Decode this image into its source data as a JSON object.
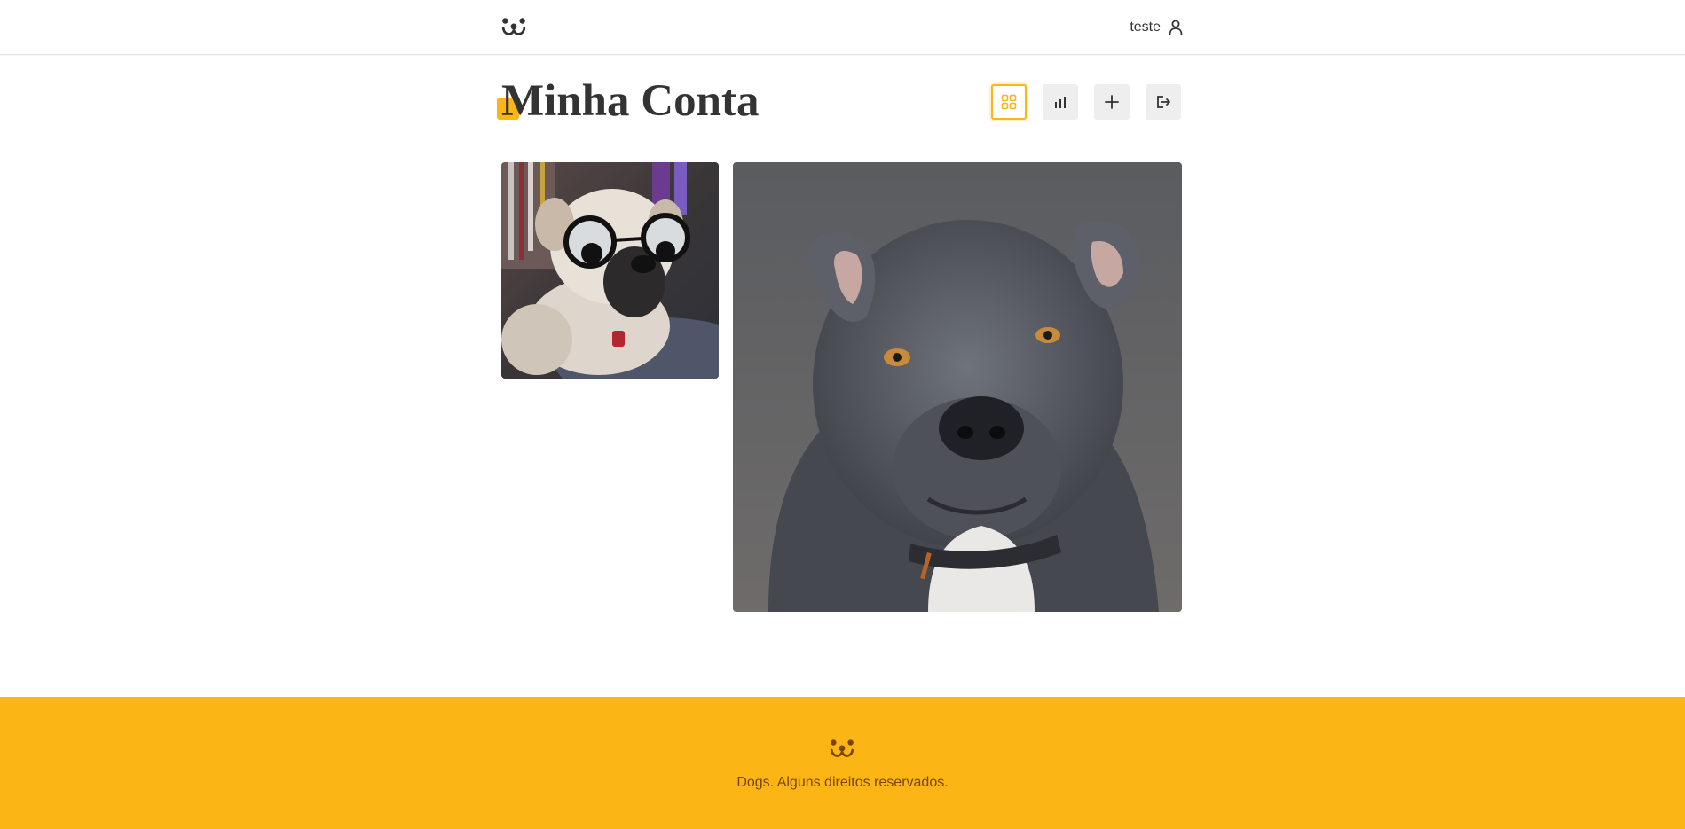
{
  "header": {
    "logo_icon": "dog-face-icon",
    "username": "teste",
    "user_icon": "user-icon"
  },
  "page": {
    "title": "Minha Conta"
  },
  "nav": {
    "items": [
      {
        "name": "feed",
        "icon": "grid-icon",
        "active": true
      },
      {
        "name": "stats",
        "icon": "bar-chart-icon",
        "active": false
      },
      {
        "name": "post",
        "icon": "plus-icon",
        "active": false
      },
      {
        "name": "logout",
        "icon": "logout-icon",
        "active": false
      }
    ]
  },
  "feed": {
    "photos": [
      {
        "subject": "white dog wearing googly-eye glasses"
      },
      {
        "subject": "grey pit bull portrait"
      }
    ]
  },
  "footer": {
    "logo_icon": "dog-face-icon",
    "text": "Dogs. Alguns direitos reservados."
  },
  "colors": {
    "accent": "#fbb515",
    "footer_text": "#764701",
    "text": "#333333",
    "button_bg": "#eeeeee"
  }
}
